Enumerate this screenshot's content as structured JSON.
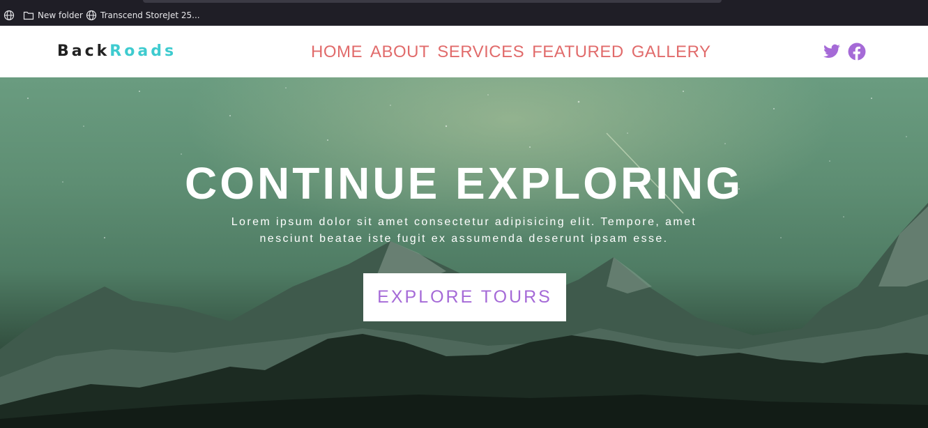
{
  "bookmarks": {
    "items": [
      {
        "label": "",
        "icon": "globe-icon"
      },
      {
        "label": "New folder",
        "icon": "folder-icon"
      },
      {
        "label": "Transcend StoreJet 25...",
        "icon": "globe-icon"
      }
    ]
  },
  "nav": {
    "logo_part1": "Back",
    "logo_part2": "Roads",
    "links": [
      "HOME",
      "ABOUT",
      "SERVICES",
      "FEATURED",
      "GALLERY"
    ],
    "social": [
      "twitter-icon",
      "facebook-icon"
    ]
  },
  "hero": {
    "title": "CONTINUE EXPLORING",
    "text": "Lorem ipsum dolor sit amet consectetur adipisicing elit. Tempore, amet nesciunt beatae iste fugit ex assumenda deserunt ipsam esse.",
    "button_label": "EXPLORE TOURS"
  },
  "colors": {
    "logo_dark": "#222222",
    "logo_accent": "#3ecbcf",
    "nav_link": "#e16b6b",
    "social_icon": "#a56ad7",
    "button_text": "#a56ad7"
  }
}
